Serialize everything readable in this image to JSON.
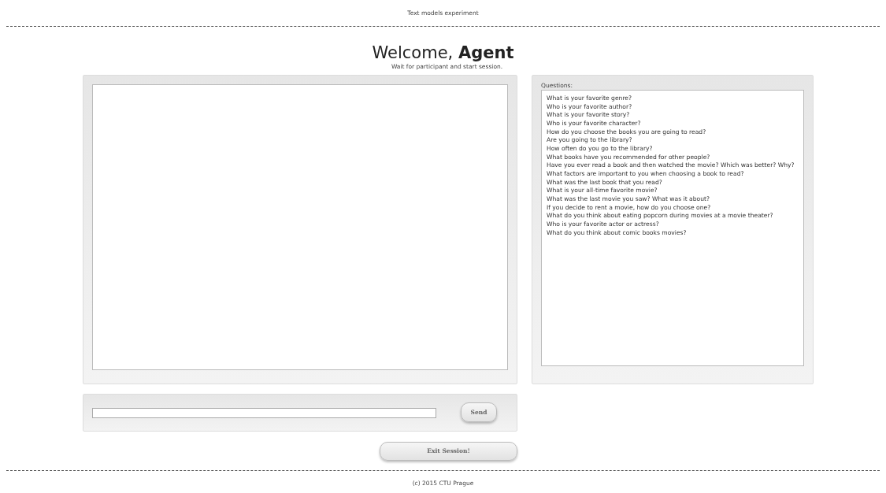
{
  "header": {
    "title": "Text models experiment"
  },
  "welcome": {
    "heading": "Welcome, **Agent**",
    "subtitle": "Wait for participant and start session."
  },
  "questions": {
    "label": "Questions:",
    "items": [
      "What is your favorite genre?",
      "Who is your favorite author?",
      "What is your favorite story?",
      "Who is your favorite character?",
      "How do you choose the books you are going to read?",
      "Are you going to the library?",
      "How often do you go to the library?",
      "What books have you recommended for other people?",
      "Have you ever read a book and then watched the movie? Which was better? Why?",
      "What factors are important to you when choosing a book to read?",
      "What was the last book that you read?",
      "What is your all-time favorite movie?",
      "What was the last movie you saw? What was it about?",
      "If you decide to rent a movie, how do you choose one?",
      "What do you think about eating popcorn during movies at a movie theater?",
      "Who is your favorite actor or actress?",
      "What do you think about comic books movies?"
    ]
  },
  "composer": {
    "send_button": "Send"
  },
  "exit_button": "Exit Session!",
  "footer": "(c) 2015 CTU Prague"
}
